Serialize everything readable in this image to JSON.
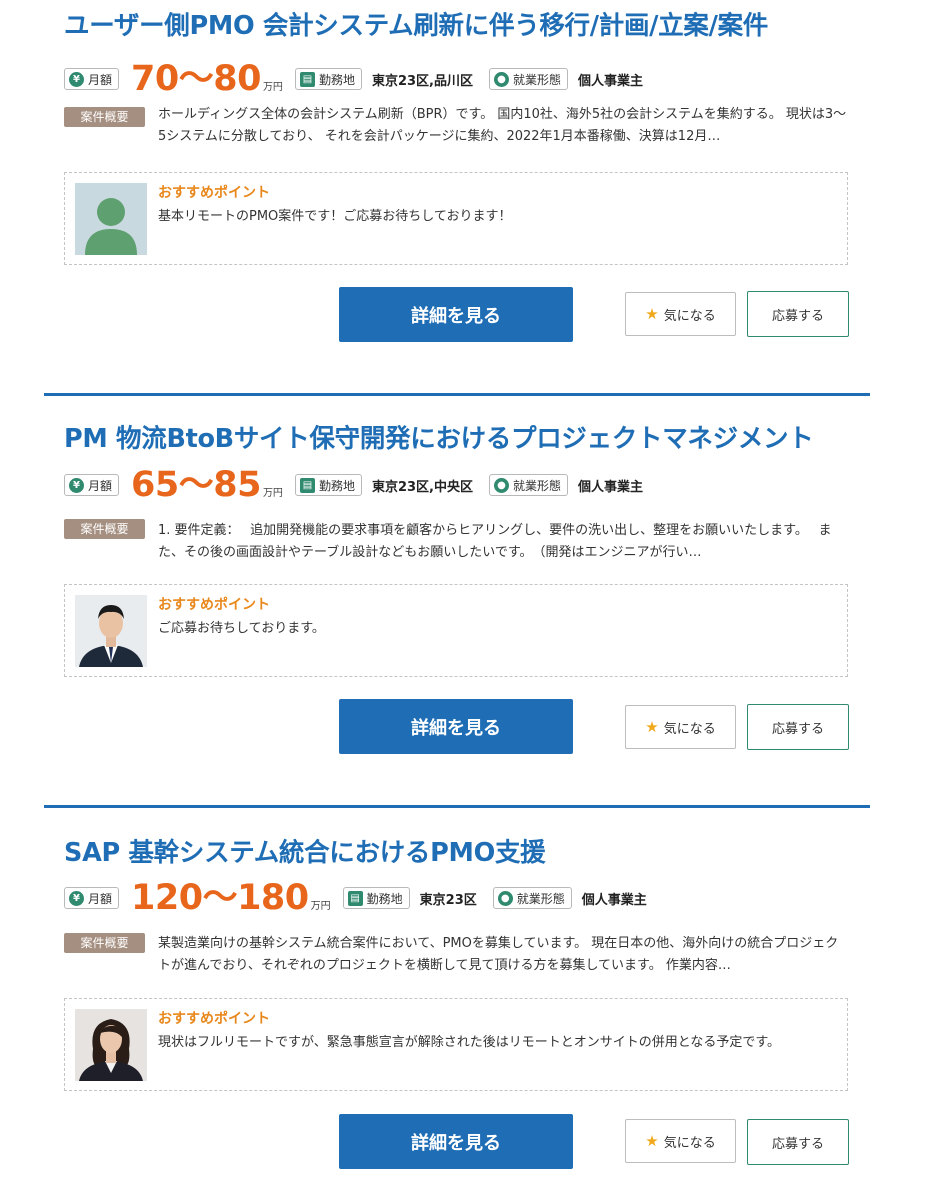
{
  "jobs": [
    {
      "title": "ユーザー側PMO 会計システム刷新に伴う移行/計画/立案/案件",
      "monthly_label": "月額",
      "price": "70〜80",
      "unit": "万円",
      "location_label": "勤務地",
      "location": "東京23区,品川区",
      "employment_label": "就業形態",
      "employment": "個人事業主",
      "summary_label": "案件概要",
      "summary": "ホールディングス全体の会計システム刷新（BPR）です。 国内10社、海外5社の会計システムを集約する。 現状は3〜5システムに分散しており、 それを会計パッケージに集約、2022年1月本番稼働、決算は12月…",
      "rec_title": "おすすめポイント",
      "rec_text": "基本リモートのPMO案件です！ご応募お待ちしております！",
      "avatar": "default-person-icon",
      "detail_button": "詳細を見る",
      "fav_button": "気になる",
      "apply_button": "応募する"
    },
    {
      "title": "PM 物流BtoBサイト保守開発におけるプロジェクトマネジメント",
      "monthly_label": "月額",
      "price": "65〜85",
      "unit": "万円",
      "location_label": "勤務地",
      "location": "東京23区,中央区",
      "employment_label": "就業形態",
      "employment": "個人事業主",
      "summary_label": "案件概要",
      "summary": "1. 要件定義：　 追加開発機能の要求事項を顧客からヒアリングし、要件の洗い出し、整理をお願いいたします。　 また、その後の画面設計やテーブル設計などもお願いしたいです。　（開発はエンジニアが行い…",
      "rec_title": "おすすめポイント",
      "rec_text": "ご応募お待ちしております。",
      "avatar": "male-recruiter-photo",
      "detail_button": "詳細を見る",
      "fav_button": "気になる",
      "apply_button": "応募する"
    },
    {
      "title": "SAP 基幹システム統合におけるPMO支援",
      "monthly_label": "月額",
      "price": "120〜180",
      "unit": "万円",
      "location_label": "勤務地",
      "location": "東京23区",
      "employment_label": "就業形態",
      "employment": "個人事業主",
      "summary_label": "案件概要",
      "summary": "某製造業向けの基幹システム統合案件において、PMOを募集しています。 現在日本の他、海外向けの統合プロジェクトが進んでおり、それぞれのプロジェクトを横断して見て頂ける方を募集しています。 作業内容…",
      "rec_title": "おすすめポイント",
      "rec_text": "現状はフルリモートですが、緊急事態宣言が解除された後はリモートとオンサイトの併用となる予定です。",
      "avatar": "female-recruiter-photo",
      "detail_button": "詳細を見る",
      "fav_button": "気になる",
      "apply_button": "応募する"
    }
  ],
  "colors": {
    "accent": "#1e6db5",
    "price": "#e8661c",
    "recommend": "#e8881c",
    "tag_icon": "#2f8a6f",
    "summary_label_bg": "#a58f80",
    "star": "#f0a91c"
  }
}
